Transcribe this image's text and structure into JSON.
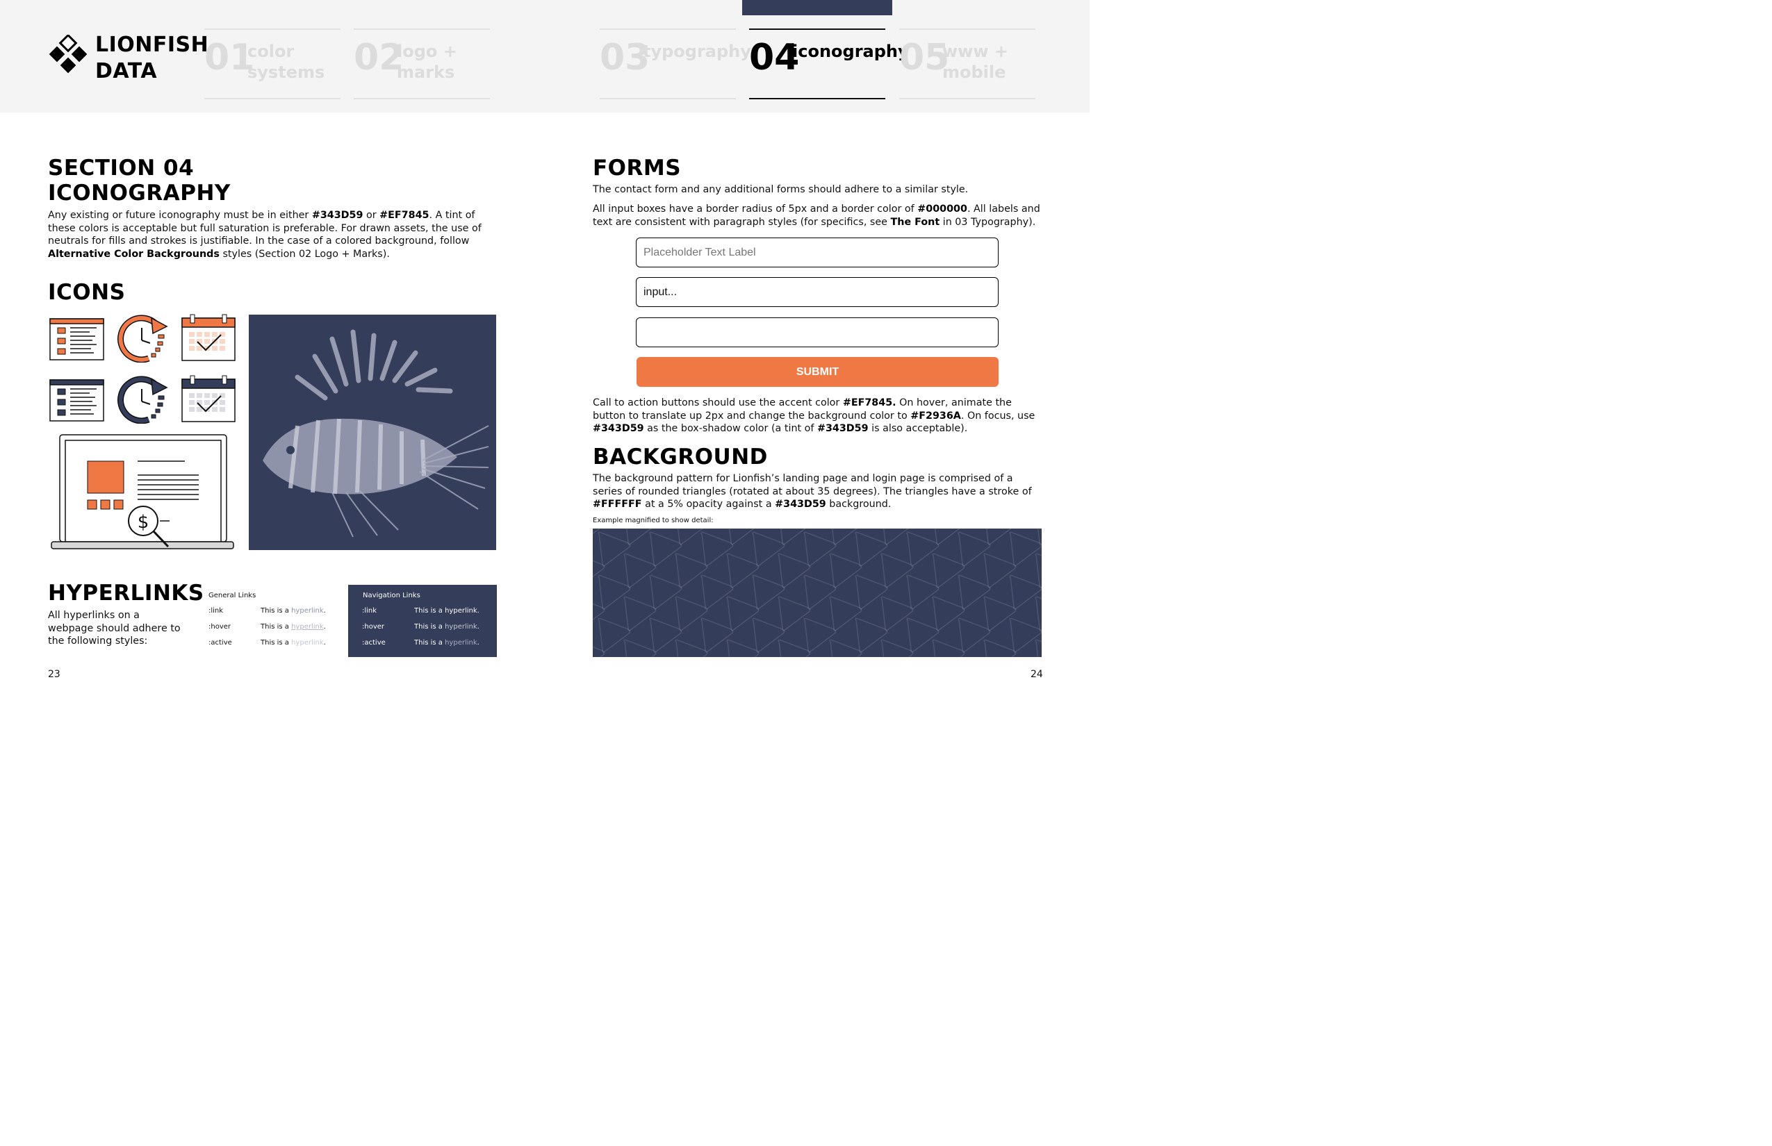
{
  "brand": {
    "line1": "LIONFISH",
    "line2": "DATA"
  },
  "nav": [
    {
      "num": "01",
      "line1": "color",
      "line2": "systems"
    },
    {
      "num": "02",
      "line1": "logo +",
      "line2": "marks"
    },
    {
      "num": "03",
      "line1": "typography",
      "line2": ""
    },
    {
      "num": "04",
      "line1": "iconography",
      "line2": ""
    },
    {
      "num": "05",
      "line1": "www +",
      "line2": "mobile"
    }
  ],
  "section": {
    "title1": "SECTION 04",
    "title2": "ICONOGRAPHY",
    "p_a": "Any existing or future iconography must be in either ",
    "c1": "#343D59",
    "p_b": " or ",
    "c2": "#EF7845",
    "p_c": ".  A tint of these colors is acceptable but full saturation is preferable. For drawn assets, the use of neutrals for fills and strokes is justifiable. In the case of a colored background, follow ",
    "alt": "Alternative Color Backgrounds",
    "p_d": " styles (Section 02 Logo + Marks)."
  },
  "icons": {
    "title": "ICONS"
  },
  "hyperlinks": {
    "title": "HYPERLINKS",
    "desc": "All hyperlinks on a webpage should adhere to the following styles:",
    "general_title": "General Links",
    "nav_title": "Navigation Links",
    "rows": [
      {
        "state": ":link",
        "text": "This is a ",
        "link": "hyperlink",
        "end": "."
      },
      {
        "state": ":hover",
        "text": "This is a ",
        "link": "hyperlink",
        "end": "."
      },
      {
        "state": ":active",
        "text": "This is a ",
        "link": "hyperlink",
        "end": "."
      }
    ]
  },
  "forms": {
    "title": "FORMS",
    "p1": "The contact form and any additional forms should adhere to a similar style.",
    "p2a": "All input boxes have a border radius of 5px and a border color of ",
    "p2c": "#000000",
    "p2b": ". All labels and text are consistent with paragraph styles (for specifics, see ",
    "p2f": "The Font",
    "p2d": " in 03 Typography).",
    "placeholder": "Placeholder Text Label",
    "input_value": "input...",
    "submit": "SUBMIT",
    "p3a": "Call to action buttons should use the accent color ",
    "p3c1": "#EF7845.",
    "p3b": " On hover, animate the button to translate up 2px and change the background color to ",
    "p3c2": "#F2936A",
    "p3d": ". On focus, use ",
    "p3c3": "#343D59",
    "p3e": " as the box-shadow color (a tint of ",
    "p3c4": "#343D59",
    "p3f": " is also acceptable)."
  },
  "background": {
    "title": "BACKGROUND",
    "p_a": "The background pattern for Lionfish’s landing page and login page is comprised of a series of rounded triangles (rotated at about 35 degrees). The triangles have a stroke of ",
    "c1": "#FFFFFF",
    "p_b": " at a 5% opacity against a ",
    "c2": "#343D59",
    "p_c": " background.",
    "caption": "Example magnified to show detail:"
  },
  "pages": {
    "left": "23",
    "right": "24"
  },
  "colors": {
    "navy": "#343D59",
    "orange": "#EF7845",
    "hover": "#F2936A"
  },
  "icon_names": [
    "list-document-icon",
    "refresh-clock-icon",
    "calendar-check-icon",
    "laptop-dollar-search-icon",
    "lionfish-image"
  ]
}
